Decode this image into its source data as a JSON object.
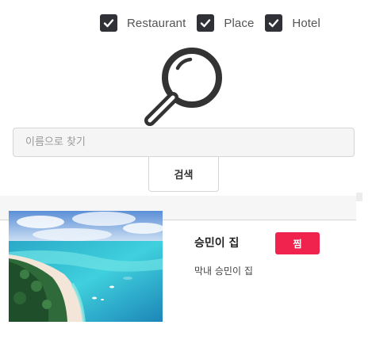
{
  "filters": [
    {
      "label": "Restaurant",
      "checked": true
    },
    {
      "label": "Place",
      "checked": true
    },
    {
      "label": "Hotel",
      "checked": true
    }
  ],
  "search": {
    "placeholder": "이름으로 찾기",
    "value": "",
    "button_label": "검색"
  },
  "results": [
    {
      "title": "승민이 집",
      "description": "막내 승민이 집",
      "bookmark_label": "찜",
      "image": "tropical-beach-photo"
    }
  ],
  "colors": {
    "checkbox_bg": "#2f3136",
    "bookmark_bg": "#f0234f",
    "input_bg": "#f5f5f5"
  },
  "icons": {
    "hero": "magnifier-icon",
    "checkmark": "checkmark-icon"
  }
}
